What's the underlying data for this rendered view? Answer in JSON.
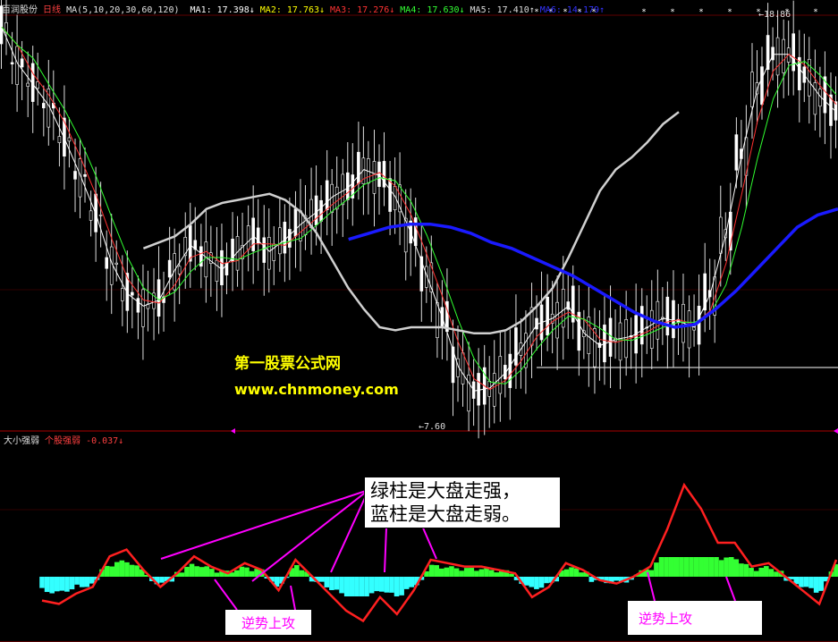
{
  "header": {
    "stock_name": "百润股份",
    "period": "日线",
    "ma_params": "MA(5,10,20,30,60,120)",
    "ma_items": [
      {
        "label": "MA1:",
        "value": "17.398↓",
        "color": "#ffffff"
      },
      {
        "label": "MA2:",
        "value": "17.763↓",
        "color": "#ffff00"
      },
      {
        "label": "MA3:",
        "value": "17.276↓",
        "color": "#ff3333"
      },
      {
        "label": "MA4:",
        "value": "17.630↓",
        "color": "#33ff33"
      },
      {
        "label": "MA5:",
        "value": "17.410↑",
        "color": "#dddddd"
      },
      {
        "label": "MA6:",
        "value": "14.179↑",
        "color": "#3333ff"
      }
    ],
    "high_mark": "←18.86"
  },
  "sub_header": {
    "indicator": "大小强弱",
    "series_label": "个股强弱",
    "value": "-0.037↓"
  },
  "low_mark": "←7.60",
  "watermark": {
    "line1": "第一股票公式网",
    "line2": "www.chnmoney.com"
  },
  "callout": {
    "line1": "绿柱是大盘走强，",
    "line2": "蓝柱是大盘走弱。"
  },
  "labels": {
    "left": "逆势上攻",
    "right": "逆势上攻"
  },
  "colors": {
    "red_line": "#ff2020",
    "green_bar": "#33ff33",
    "cyan_bar": "#33ffff",
    "blue_ma": "#1a1aff",
    "white_ma": "#d0d0d0",
    "annotation": "#ff00ff"
  },
  "chart_data": [
    {
      "type": "line",
      "note_series": "price panel with moving averages",
      "series": [
        {
          "name": "MA5",
          "values": [
            20.2,
            19.0,
            18.3,
            17.6,
            16.5,
            15.3,
            14.0,
            12.4,
            11.4,
            11.0,
            11.2,
            12.2,
            13.0,
            12.6,
            12.2,
            12.8,
            13.3,
            12.8,
            13.2,
            13.7,
            14.1,
            14.6,
            14.9,
            15.5,
            15.3,
            14.6,
            13.4,
            12.0,
            10.6,
            9.0,
            8.2,
            8.3,
            8.8,
            9.6,
            10.4,
            10.6,
            11.0,
            10.1,
            9.7,
            9.9,
            10.0,
            10.3,
            10.6,
            10.5,
            10.3,
            11.4,
            13.4,
            16.0,
            18.2,
            19.3,
            19.3,
            18.6,
            17.9,
            17.4
          ]
        },
        {
          "name": "MA60",
          "values": [
            null,
            null,
            null,
            null,
            null,
            null,
            null,
            null,
            null,
            12.9,
            13.1,
            13.3,
            13.7,
            14.2,
            14.4,
            14.5,
            14.6,
            14.7,
            14.5,
            14.1,
            13.4,
            12.5,
            11.6,
            10.9,
            10.3,
            10.2,
            10.3,
            10.3,
            10.3,
            10.2,
            10.1,
            10.1,
            10.2,
            10.5,
            11.0,
            11.6,
            12.6,
            13.7,
            14.8,
            15.5,
            15.9,
            16.4,
            17.0,
            17.4
          ]
        },
        {
          "name": "MA120",
          "values": [
            null,
            null,
            null,
            null,
            null,
            null,
            null,
            null,
            null,
            null,
            null,
            null,
            null,
            null,
            null,
            null,
            null,
            13.2,
            13.4,
            13.6,
            13.7,
            13.7,
            13.6,
            13.4,
            13.1,
            12.9,
            12.6,
            12.3,
            12.0,
            11.6,
            11.2,
            10.8,
            10.5,
            10.3,
            10.4,
            10.9,
            11.5,
            12.2,
            12.9,
            13.6,
            14.0,
            14.2
          ]
        }
      ]
    },
    {
      "type": "bar",
      "note_series": "大小强弱 sub-panel",
      "series": [
        {
          "name": "个股强弱",
          "values": [
            -0.7,
            -0.8,
            -0.5,
            -0.3,
            0.6,
            0.8,
            0.2,
            -0.3,
            0.1,
            0.6,
            0.3,
            0.1,
            0.4,
            0.2,
            -0.4,
            0.5,
            0.0,
            -0.5,
            -1.0,
            -1.3,
            -0.6,
            -1.1,
            -0.4,
            0.5,
            0.4,
            0.3,
            0.3,
            0.2,
            0.1,
            -0.6,
            -0.3,
            0.4,
            0.2,
            -0.1,
            -0.2,
            0.0,
            0.3,
            1.4,
            2.7,
            2.0,
            1.0,
            1.0,
            0.3,
            0.4,
            0.0,
            -0.4,
            -0.8,
            0.5
          ]
        }
      ]
    }
  ]
}
